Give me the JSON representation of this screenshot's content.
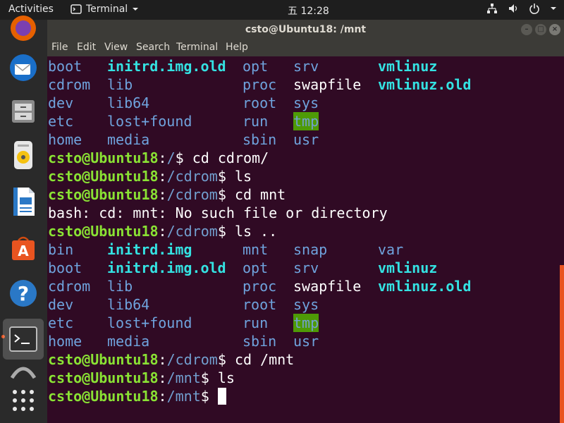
{
  "topbar": {
    "activities": "Activities",
    "app_name": "Terminal",
    "clock": "五 12:28"
  },
  "window": {
    "title": "csto@Ubuntu18: /mnt",
    "menu": [
      "File",
      "Edit",
      "View",
      "Search",
      "Terminal",
      "Help"
    ]
  },
  "terminal": {
    "lines": [
      {
        "type": "ls",
        "cols": [
          "boot",
          "initrd.img.old",
          "opt",
          "srv",
          "vmlinuz"
        ]
      },
      {
        "type": "ls",
        "cols": [
          "cdrom",
          "lib",
          "proc",
          "swapfile",
          "vmlinuz.old"
        ]
      },
      {
        "type": "ls",
        "cols": [
          "dev",
          "lib64",
          "root",
          "sys",
          ""
        ]
      },
      {
        "type": "ls",
        "cols": [
          "etc",
          "lost+found",
          "run",
          "tmp",
          ""
        ]
      },
      {
        "type": "ls",
        "cols": [
          "home",
          "media",
          "sbin",
          "usr",
          ""
        ]
      },
      {
        "type": "prompt",
        "user": "csto@Ubuntu18",
        "path": "/",
        "cmd": "cd cdrom/"
      },
      {
        "type": "prompt",
        "user": "csto@Ubuntu18",
        "path": "/cdrom",
        "cmd": "ls"
      },
      {
        "type": "prompt",
        "user": "csto@Ubuntu18",
        "path": "/cdrom",
        "cmd": "cd mnt"
      },
      {
        "type": "text",
        "text": "bash: cd: mnt: No such file or directory"
      },
      {
        "type": "prompt",
        "user": "csto@Ubuntu18",
        "path": "/cdrom",
        "cmd": "ls .."
      },
      {
        "type": "ls",
        "cols": [
          "bin",
          "initrd.img",
          "mnt",
          "snap",
          "var"
        ]
      },
      {
        "type": "ls",
        "cols": [
          "boot",
          "initrd.img.old",
          "opt",
          "srv",
          "vmlinuz"
        ]
      },
      {
        "type": "ls",
        "cols": [
          "cdrom",
          "lib",
          "proc",
          "swapfile",
          "vmlinuz.old"
        ]
      },
      {
        "type": "ls",
        "cols": [
          "dev",
          "lib64",
          "root",
          "sys",
          ""
        ]
      },
      {
        "type": "ls",
        "cols": [
          "etc",
          "lost+found",
          "run",
          "tmp",
          ""
        ]
      },
      {
        "type": "ls",
        "cols": [
          "home",
          "media",
          "sbin",
          "usr",
          ""
        ]
      },
      {
        "type": "prompt",
        "user": "csto@Ubuntu18",
        "path": "/cdrom",
        "cmd": "cd /mnt"
      },
      {
        "type": "prompt",
        "user": "csto@Ubuntu18",
        "path": "/mnt",
        "cmd": "ls"
      },
      {
        "type": "prompt",
        "user": "csto@Ubuntu18",
        "path": "/mnt",
        "cmd": ""
      }
    ]
  },
  "dock": {
    "items": [
      "firefox-icon",
      "thunderbird-icon",
      "files-icon",
      "rhythmbox-icon",
      "writer-icon",
      "software-icon",
      "help-icon",
      "terminal-icon",
      "partial-icon",
      "show-apps-icon"
    ]
  },
  "colors": {
    "prompt_user": "#8ae234",
    "prompt_path": "#729fcf",
    "ls_dir": "#729fcf",
    "ls_link": "#34e2e2",
    "ls_file": "#ffffff",
    "tmp_bg": "#4e9a06",
    "background": "#300A24",
    "accent": "#e95420"
  }
}
